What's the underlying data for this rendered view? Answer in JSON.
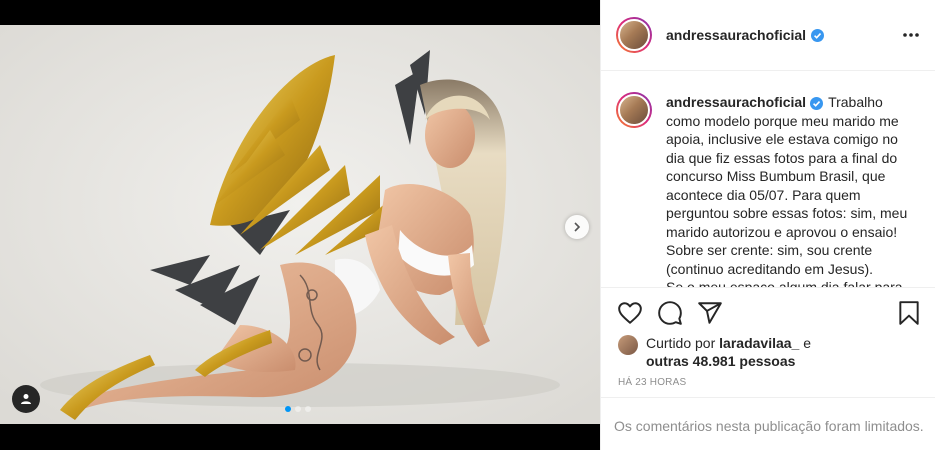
{
  "post": {
    "author": {
      "username": "andressaurachoficial",
      "verified": true
    },
    "caption_lines": [
      "Trabalho",
      "como modelo porque meu marido me",
      "apoia, inclusive ele estava comigo no",
      "dia que fiz essas fotos para a final do",
      "concurso Miss Bumbum Brasil, que",
      "acontece dia 05/07. Para quem",
      "perguntou sobre essas fotos: sim, meu",
      "marido autorizou e aprovou o ensaio!",
      "Sobre ser crente: sim, sou crente",
      "(continuo acreditando em Jesus).",
      "Se o meu espaço algum dia falar para"
    ],
    "likes": {
      "prefix": "Curtido por",
      "user": "laradavilaa_",
      "conjunction": "e",
      "others": "outras 48.981 pessoas"
    },
    "timestamp": "HÁ 23 HORAS",
    "comments_notice": "Os comentários nesta publicação foram limitados.",
    "carousel": {
      "total": 3,
      "current": 1
    }
  },
  "icons": {
    "more": "more-options-icon",
    "like": "heart-icon",
    "comment": "comment-icon",
    "share": "share-icon",
    "save": "bookmark-icon",
    "next": "chevron-right-icon",
    "tags": "user-tag-icon",
    "verified": "verified-badge-icon"
  },
  "colors": {
    "accent": "#0095f6",
    "text": "#262626",
    "muted": "#8e8e8e",
    "border": "#efefef"
  }
}
